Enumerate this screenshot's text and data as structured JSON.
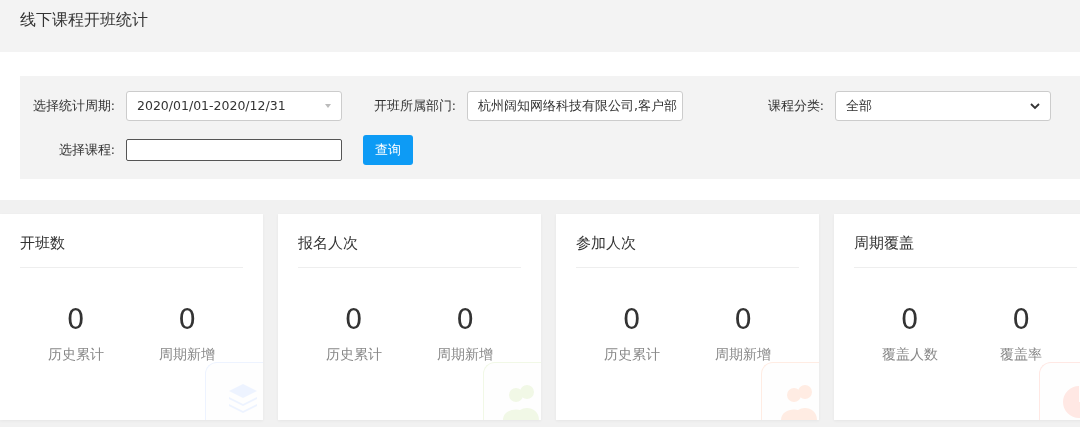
{
  "page_title": "线下课程开班统计",
  "filters": [
    {
      "kind": "daterange",
      "label": "选择统计周期:",
      "value": "2020/01/01-2020/12/31"
    },
    {
      "kind": "text",
      "label": "开班所属部门:",
      "value": "杭州阔知网络科技有限公司,客户部"
    },
    {
      "kind": "select",
      "label": "课程分类:",
      "value": "全部"
    },
    {
      "kind": "input",
      "label": "选择课程:"
    }
  ],
  "query_button": "查询",
  "cards": [
    {
      "title": "开班数",
      "kind": "layers",
      "color": "#edf3ff",
      "stats": [
        {
          "value": "0",
          "label": "历史累计"
        },
        {
          "value": "0",
          "label": "周期新增"
        }
      ]
    },
    {
      "title": "报名人次",
      "kind": "people",
      "color": "#f1f8e6",
      "stats": [
        {
          "value": "0",
          "label": "历史累计"
        },
        {
          "value": "0",
          "label": "周期新增"
        }
      ]
    },
    {
      "title": "参加人次",
      "kind": "people",
      "color": "#ffece3",
      "stats": [
        {
          "value": "0",
          "label": "历史累计"
        },
        {
          "value": "0",
          "label": "周期新增"
        }
      ]
    },
    {
      "title": "周期覆盖",
      "kind": "pie",
      "color": "#ffe8e4",
      "stats": [
        {
          "value": "0",
          "label": "覆盖人数"
        },
        {
          "value": "0",
          "label": "覆盖率"
        }
      ]
    }
  ]
}
